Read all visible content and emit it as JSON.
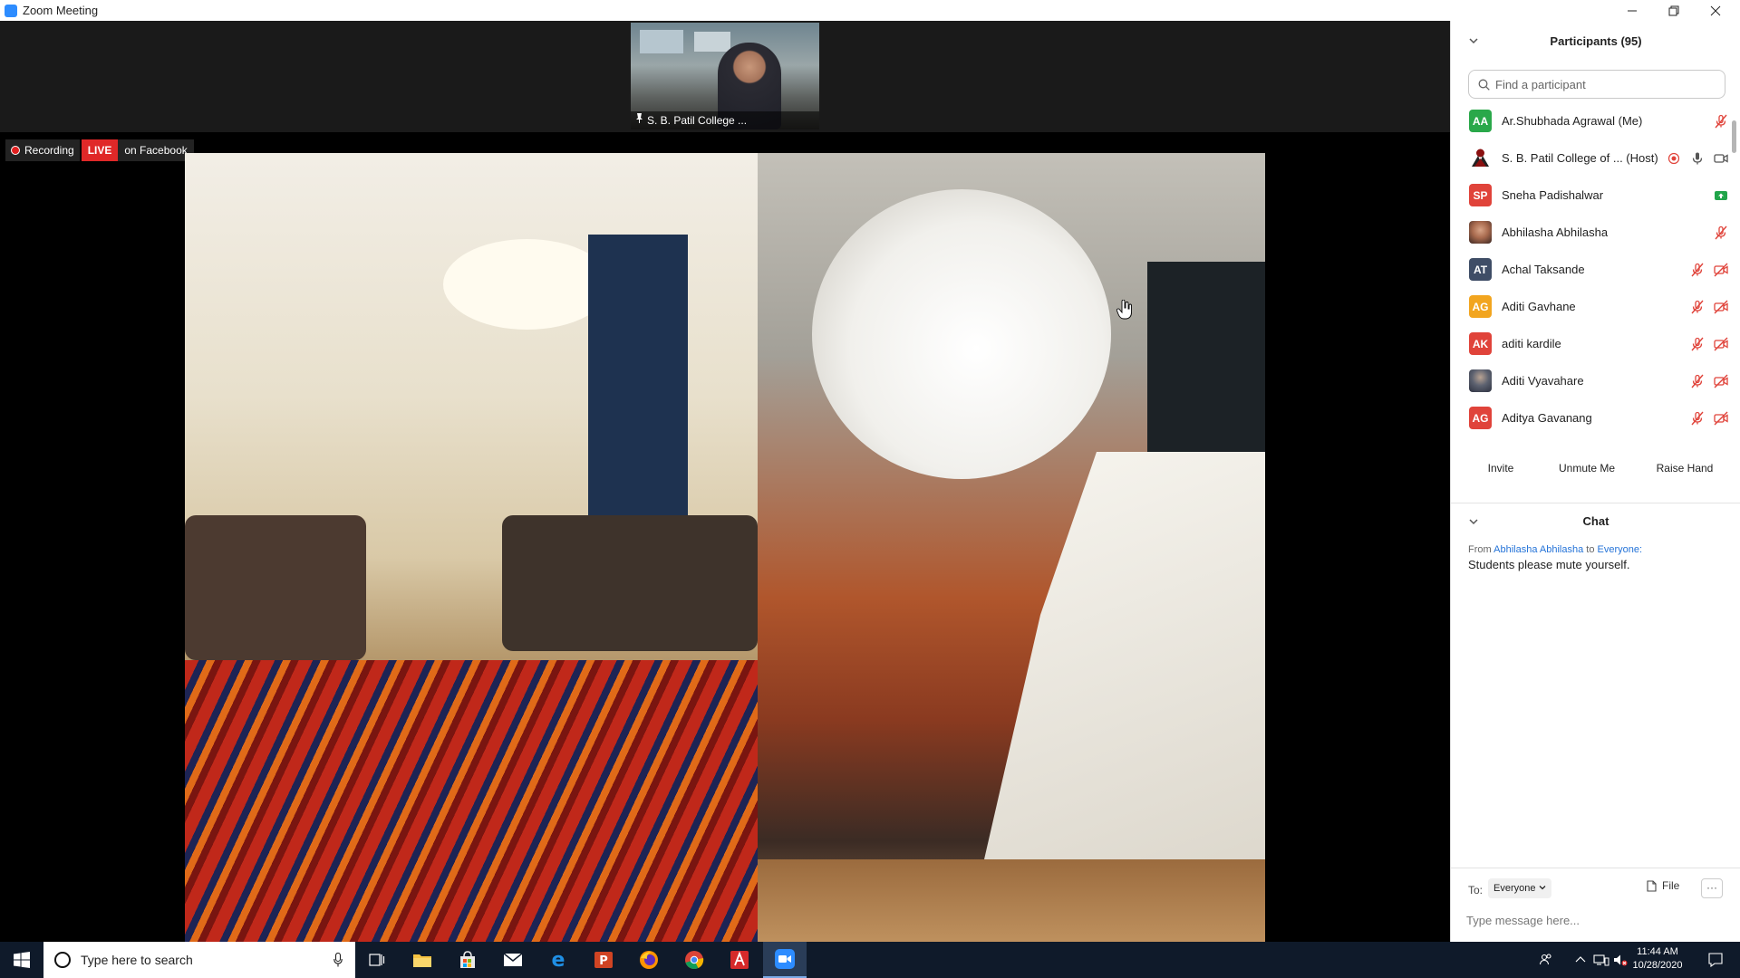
{
  "window": {
    "title": "Zoom Meeting",
    "controls": [
      "minimize-icon",
      "restore-icon",
      "close-icon"
    ]
  },
  "meeting": {
    "video_thumbnail": {
      "name": "S. B. Patil College ..."
    },
    "recording": {
      "label": "Recording",
      "live_label": "LIVE",
      "live_destination": "on Facebook"
    }
  },
  "participants": {
    "title": "Participants (95)",
    "search_placeholder": "Find a participant",
    "items": [
      {
        "initials": "AA",
        "name": "Ar.Shubhada Agrawal (Me)",
        "avatar_color": "#2aa84a",
        "audio": "muted",
        "video": "none"
      },
      {
        "initials": "",
        "name": "S. B. Patil College of ...  (Host)",
        "avatar_color": "#ffffff",
        "audio": "on",
        "video": "on",
        "recording": true
      },
      {
        "initials": "SP",
        "name": "Sneha Padishalwar",
        "avatar_color": "#e0433a",
        "audio": "none",
        "video": "share"
      },
      {
        "initials": "",
        "name": "Abhilasha Abhilasha",
        "avatar_color": "#c78d6e",
        "audio": "muted",
        "video": "none"
      },
      {
        "initials": "AT",
        "name": "Achal Taksande",
        "avatar_color": "#3f4d66",
        "audio": "muted",
        "video": "off"
      },
      {
        "initials": "AG",
        "name": "Aditi  Gavhane",
        "avatar_color": "#f2a51f",
        "audio": "muted",
        "video": "off"
      },
      {
        "initials": "AK",
        "name": "aditi kardile",
        "avatar_color": "#e0433a",
        "audio": "muted",
        "video": "off"
      },
      {
        "initials": "",
        "name": "Aditi Vyavahare",
        "avatar_color": "#4a5466",
        "audio": "muted",
        "video": "off"
      },
      {
        "initials": "AG",
        "name": "Aditya Gavanang",
        "avatar_color": "#e0433a",
        "audio": "muted",
        "video": "off"
      }
    ],
    "buttons": {
      "invite": "Invite",
      "unmute": "Unmute Me",
      "raise_hand": "Raise Hand"
    }
  },
  "chat": {
    "title": "Chat",
    "messages": [
      {
        "from_prefix": "From",
        "sender": "Abhilasha Abhilasha",
        "to_prefix": "to",
        "recipient": "Everyone:",
        "text": "Students please mute yourself."
      }
    ],
    "to_label": "To:",
    "to_value": "Everyone",
    "file_label": "File",
    "more_label": "···",
    "input_placeholder": "Type message here..."
  },
  "taskbar": {
    "search_placeholder": "Type here to search",
    "time": "11:44 AM",
    "date": "10/28/2020",
    "apps": [
      "task-view-icon",
      "file-explorer-icon",
      "store-icon",
      "mail-icon",
      "edge-icon",
      "powerpoint-icon",
      "firefox-icon",
      "chrome-icon",
      "acrobat-icon",
      "zoom-icon"
    ]
  },
  "colors": {
    "zoom_blue": "#2D8CFF",
    "muted_red": "#e0433a",
    "live_red": "#e02828",
    "link_blue": "#2473d8"
  }
}
